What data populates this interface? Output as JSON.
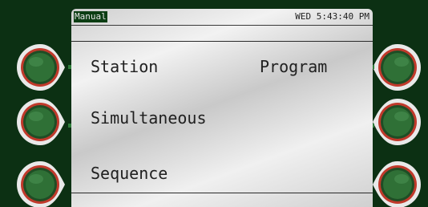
{
  "lcd": {
    "mode": "Manual",
    "clock": "WED 5:43:40 PM",
    "menu": {
      "station": "Station",
      "program": "Program",
      "simultaneous": "Simultaneous",
      "sequence": "Sequence"
    }
  },
  "softkeys": {
    "left": [
      "left-softkey-1",
      "left-softkey-2",
      "left-softkey-3"
    ],
    "right": [
      "right-softkey-1",
      "right-softkey-2",
      "right-softkey-3"
    ]
  },
  "colors": {
    "bezel": "#0c3013",
    "button_fill": "#2b6a33",
    "button_ring": "#c0392b",
    "lcd_text": "#202020"
  }
}
